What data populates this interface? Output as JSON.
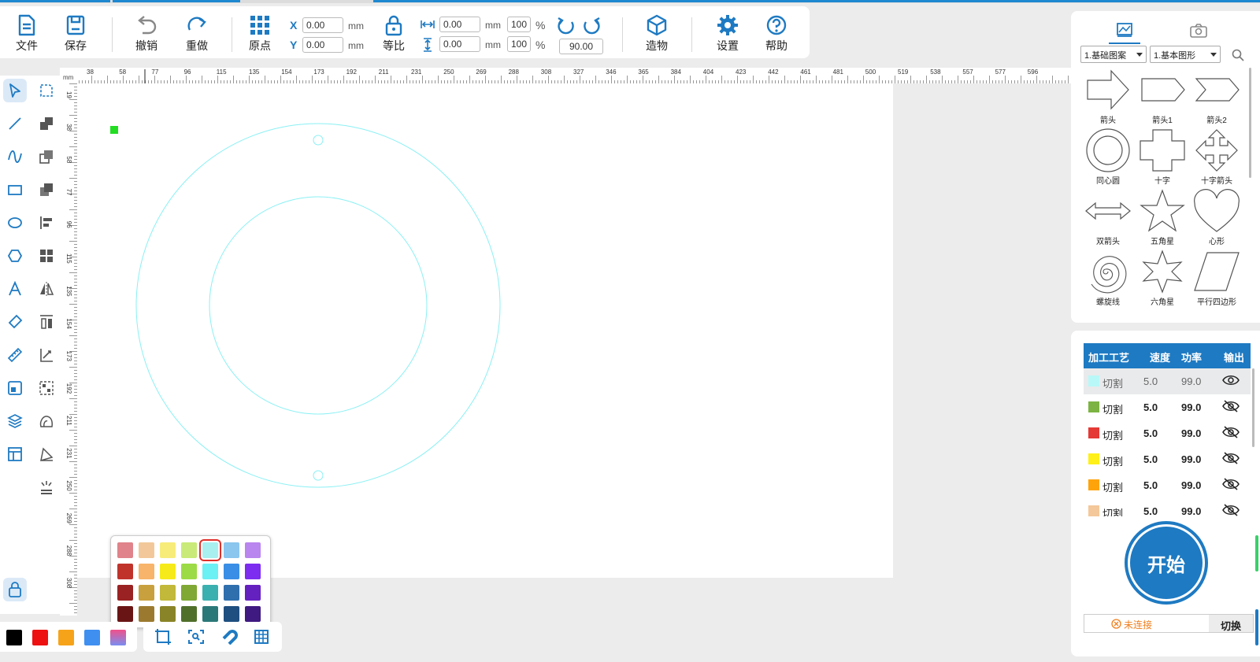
{
  "toolbar": {
    "file_label": "文件",
    "save_label": "保存",
    "undo_label": "撤销",
    "redo_label": "重做",
    "origin_label": "原点",
    "x_label": "X",
    "y_label": "Y",
    "x_value": "0.00",
    "y_value": "0.00",
    "unit_mm": "mm",
    "ratio_label": "等比",
    "width_value": "0.00",
    "height_value": "0.00",
    "width_pct": "100",
    "height_pct": "100",
    "pct_symbol": "%",
    "rotation_value": "90.00",
    "build_label": "造物",
    "settings_label": "设置",
    "help_label": "帮助"
  },
  "ruler": {
    "unit": "mm",
    "h_ticks": [
      "38",
      "58",
      "77",
      "96",
      "115",
      "135",
      "154",
      "173",
      "192",
      "211",
      "231",
      "250",
      "269",
      "288",
      "308",
      "327",
      "346",
      "365",
      "384",
      "404",
      "423",
      "442",
      "461",
      "481",
      "500",
      "519",
      "538",
      "557",
      "577",
      "596"
    ],
    "v_ticks": [
      "19",
      "38",
      "58",
      "77",
      "96",
      "115",
      "135",
      "154",
      "173",
      "192",
      "211",
      "231",
      "250",
      "269",
      "288",
      "308"
    ]
  },
  "left_tools": [
    "select-tool",
    "node-edit-tool",
    "line-tool",
    "boolean-union-tool",
    "curve-tool",
    "boolean-subtract-tool",
    "rectangle-tool",
    "boolean-intersect-tool",
    "ellipse-tool",
    "align-tool",
    "polygon-tool",
    "array-tool",
    "text-tool",
    "mirror-tool",
    "eraser-tool",
    "distribute-tool",
    "ruler-tool",
    "measure-tool",
    "image-tool",
    "group-tool",
    "layers-tool",
    "trace-tool",
    "panel-tool",
    "path-tool",
    "light-tool"
  ],
  "palette": {
    "selected_index": 4,
    "colors": [
      "#e0838a",
      "#f2c89a",
      "#f7ec7a",
      "#c9ea78",
      "#a8f0f0",
      "#8ac6ee",
      "#b985ee",
      "#c0332b",
      "#f7b46a",
      "#f6ea1a",
      "#9ddb46",
      "#6bf0f4",
      "#3b8ee6",
      "#7c2df0",
      "#9a2222",
      "#c9a03e",
      "#c2b83a",
      "#7fa834",
      "#3bb0b0",
      "#2f6fae",
      "#6520c0",
      "#6a1515",
      "#9b7a30",
      "#8a8428",
      "#50702a",
      "#2b7878",
      "#1f4f80",
      "#3f1a80"
    ]
  },
  "bottom_colors": [
    "#000000",
    "#ee1111",
    "#f6a31a",
    "#3f8ff0",
    "#f0508a"
  ],
  "right_panel": {
    "tabs": [
      "image-tab",
      "camera-tab"
    ],
    "category_select": "1.基础图案",
    "shape_select": "1.基本图形",
    "shapes": [
      {
        "name": "箭头",
        "icon": "arrow-shape-icon"
      },
      {
        "name": "箭头1",
        "icon": "arrow1-shape-icon"
      },
      {
        "name": "箭头2",
        "icon": "arrow2-shape-icon"
      },
      {
        "name": "同心圆",
        "icon": "concentric-circle-shape-icon"
      },
      {
        "name": "十字",
        "icon": "cross-shape-icon"
      },
      {
        "name": "十字箭头",
        "icon": "cross-arrow-shape-icon"
      },
      {
        "name": "双箭头",
        "icon": "double-arrow-shape-icon"
      },
      {
        "name": "五角星",
        "icon": "five-point-star-shape-icon"
      },
      {
        "name": "心形",
        "icon": "heart-shape-icon"
      },
      {
        "name": "螺旋线",
        "icon": "spiral-shape-icon"
      },
      {
        "name": "六角星",
        "icon": "six-point-star-shape-icon"
      },
      {
        "name": "平行四边形",
        "icon": "parallelogram-shape-icon"
      }
    ]
  },
  "process_table": {
    "headers": [
      "加工工艺",
      "速度",
      "功率",
      "输出"
    ],
    "rows": [
      {
        "color": "#b8f8f8",
        "process": "切割",
        "speed": "5.0",
        "power": "99.0",
        "visible": true
      },
      {
        "color": "#7cb342",
        "process": "切割",
        "speed": "5.0",
        "power": "99.0",
        "visible": false
      },
      {
        "color": "#e53935",
        "process": "切割",
        "speed": "5.0",
        "power": "99.0",
        "visible": false
      },
      {
        "color": "#fff01a",
        "process": "切割",
        "speed": "5.0",
        "power": "99.0",
        "visible": false
      },
      {
        "color": "#ffa30a",
        "process": "切割",
        "speed": "5.0",
        "power": "99.0",
        "visible": false
      },
      {
        "color": "#f4c89a",
        "process": "切割",
        "speed": "5.0",
        "power": "99.0",
        "visible": false
      }
    ]
  },
  "start_label": "开始",
  "connection": {
    "status": "未连接",
    "switch_label": "切换"
  },
  "colors": {
    "accent": "#1e7ac2",
    "canvas_shape": "#8af0f4",
    "marker": "#22dd22"
  }
}
